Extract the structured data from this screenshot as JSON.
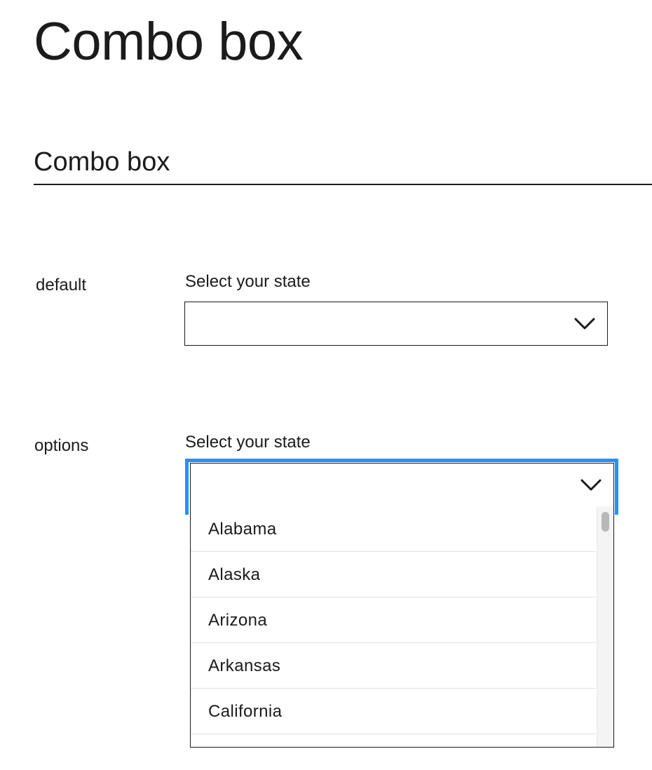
{
  "page": {
    "title": "Combo box"
  },
  "section": {
    "title": "Combo box"
  },
  "examples": [
    {
      "row_label": "default",
      "field_label": "Select your state",
      "value": "",
      "expanded": false
    },
    {
      "row_label": "options",
      "field_label": "Select your state",
      "value": "",
      "expanded": true,
      "options": [
        "Alabama",
        "Alaska",
        "Arizona",
        "Arkansas",
        "California"
      ]
    }
  ],
  "icons": {
    "toggle": "chevron-down-icon"
  },
  "colors": {
    "text": "#1b1b1b",
    "focus": "#2491ff",
    "divider": "#dfe1e2"
  }
}
